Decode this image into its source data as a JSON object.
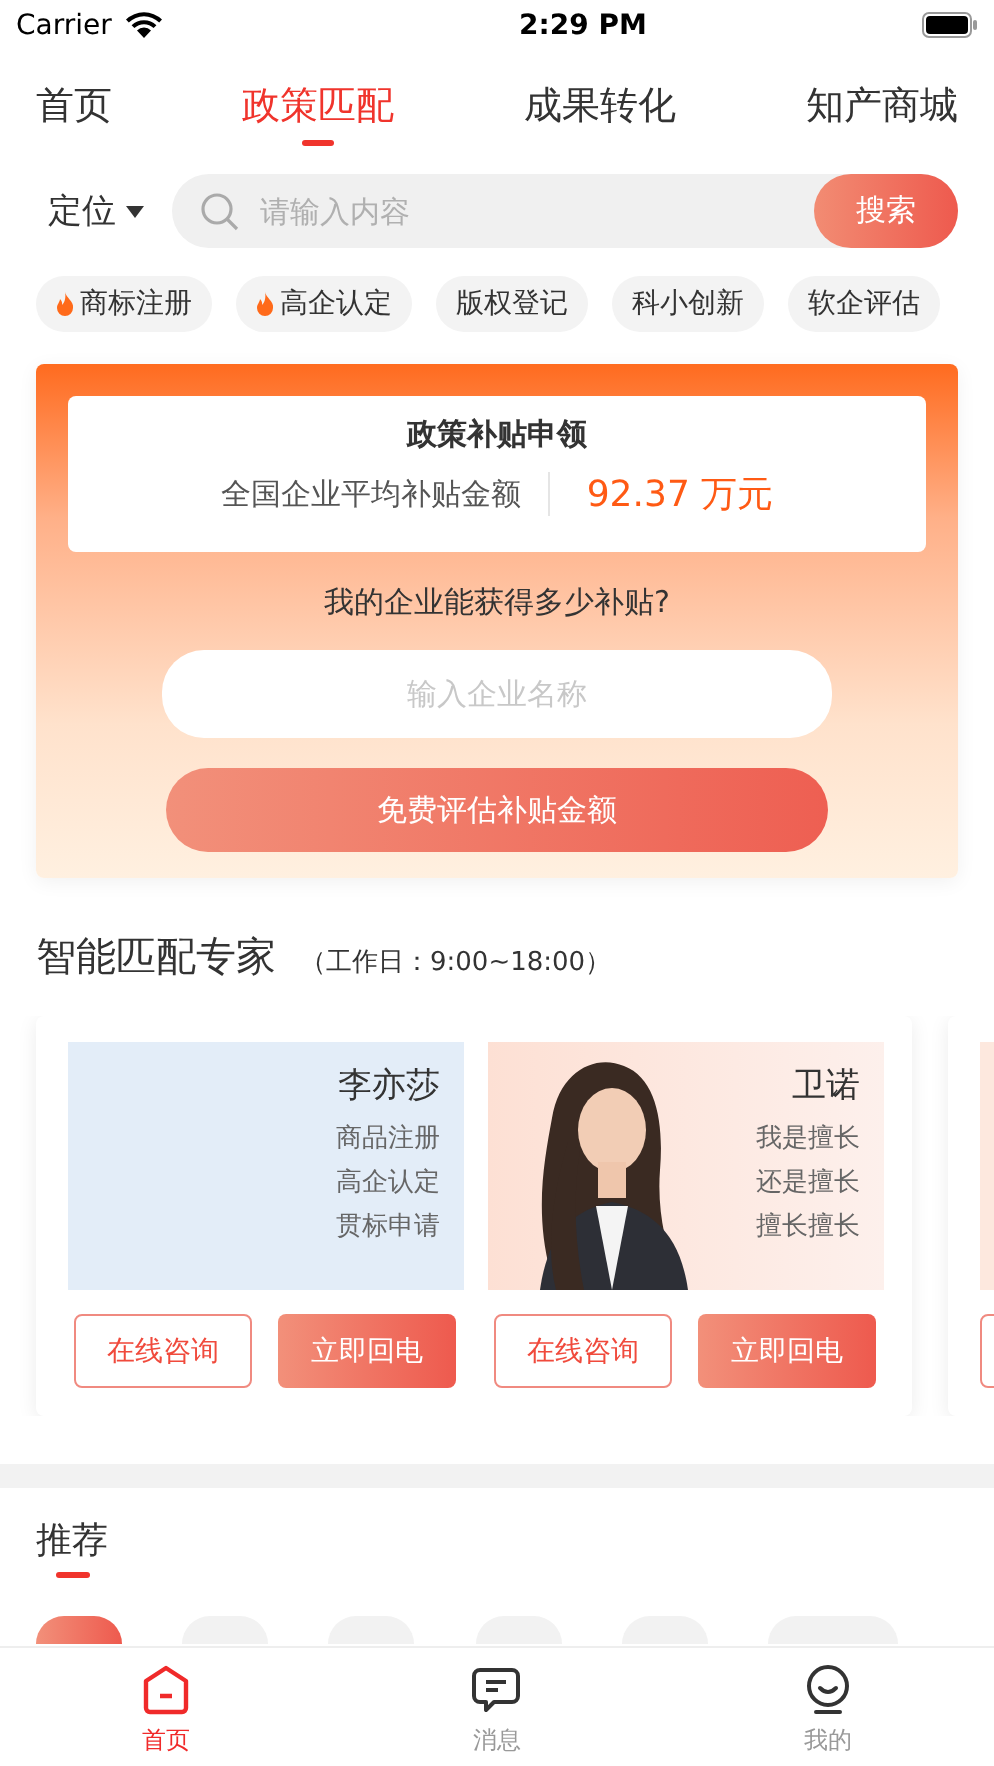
{
  "status_bar": {
    "carrier": "Carrier",
    "time": "2:29 PM"
  },
  "tabs": [
    {
      "label": "首页",
      "selected": false
    },
    {
      "label": "政策匹配",
      "selected": true
    },
    {
      "label": "成果转化",
      "selected": false
    },
    {
      "label": "知产商城",
      "selected": false
    }
  ],
  "search": {
    "location": "定位",
    "placeholder": "请输入内容",
    "button": "搜索"
  },
  "quick_tags": [
    {
      "label": "商标注册",
      "hot": true
    },
    {
      "label": "高企认定",
      "hot": true
    },
    {
      "label": "版权登记",
      "hot": false
    },
    {
      "label": "科小创新",
      "hot": false
    },
    {
      "label": "软企评估",
      "hot": false
    }
  ],
  "subsidy": {
    "title": "政策补贴申领",
    "label": "全国企业平均补贴金额",
    "amount": "92.37 万元",
    "question": "我的企业能获得多少补贴?",
    "placeholder": "输入企业名称",
    "button": "免费评估补贴金额"
  },
  "experts_section": {
    "title": "智能匹配专家",
    "hours": "（工作日：9:00~18:00）"
  },
  "experts": [
    {
      "name": "李亦莎",
      "skills": [
        "商品注册",
        "高企认定",
        "贯标申请"
      ],
      "kind": "plain",
      "consult": "在线咨询",
      "callback": "立即回电"
    },
    {
      "name": "卫诺",
      "skills": [
        "我是擅长",
        "还是擅长",
        "擅长擅长"
      ],
      "kind": "picture",
      "consult": "在线咨询",
      "callback": "立即回电"
    }
  ],
  "recommend": {
    "title": "推荐",
    "filters": [
      {
        "selected": true
      },
      {
        "selected": false
      },
      {
        "selected": false
      },
      {
        "selected": false
      },
      {
        "selected": false
      },
      {
        "selected": false
      }
    ]
  },
  "bottom_nav": [
    {
      "label": "首页",
      "kind": "home",
      "selected": true
    },
    {
      "label": "消息",
      "kind": "message",
      "selected": false
    },
    {
      "label": "我的",
      "kind": "profile",
      "selected": false
    }
  ]
}
